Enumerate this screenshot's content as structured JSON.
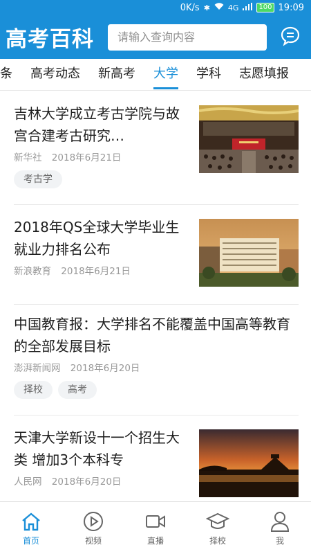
{
  "status_bar": {
    "speed": "0K/s",
    "network": "4G",
    "battery": "100",
    "time": "19:09"
  },
  "header": {
    "logo": "高考百科",
    "search_placeholder": "请输入查询内容"
  },
  "tabs": [
    {
      "label": "头条"
    },
    {
      "label": "高考动态"
    },
    {
      "label": "新高考"
    },
    {
      "label": "大学",
      "active": true
    },
    {
      "label": "学科"
    },
    {
      "label": "志愿填报"
    }
  ],
  "articles": [
    {
      "title": "吉林大学成立考古学院与故宫合建考古研究…",
      "source": "新华社",
      "date": "2018年6月21日",
      "tags": [
        "考古学"
      ]
    },
    {
      "title": "2018年QS全球大学毕业生就业力排名公布",
      "source": "新浪教育",
      "date": "2018年6月21日",
      "tags": []
    },
    {
      "title": "中国教育报：大学排名不能覆盖中国高等教育的全部发展目标",
      "source": "澎湃新闻网",
      "date": "2018年6月20日",
      "tags": [
        "择校",
        "高考"
      ]
    },
    {
      "title": "天津大学新设十一个招生大类 增加3个本科专",
      "source": "人民网",
      "date": "2018年6月20日",
      "tags": []
    }
  ],
  "bottom_nav": [
    {
      "label": "首页",
      "icon": "home-icon",
      "active": true
    },
    {
      "label": "视频",
      "icon": "play-icon"
    },
    {
      "label": "直播",
      "icon": "video-camera-icon"
    },
    {
      "label": "择校",
      "icon": "graduation-cap-icon"
    },
    {
      "label": "我",
      "icon": "user-icon"
    }
  ],
  "colors": {
    "brand": "#1a8fd8",
    "text": "#1e1e1e",
    "meta": "#999999"
  }
}
